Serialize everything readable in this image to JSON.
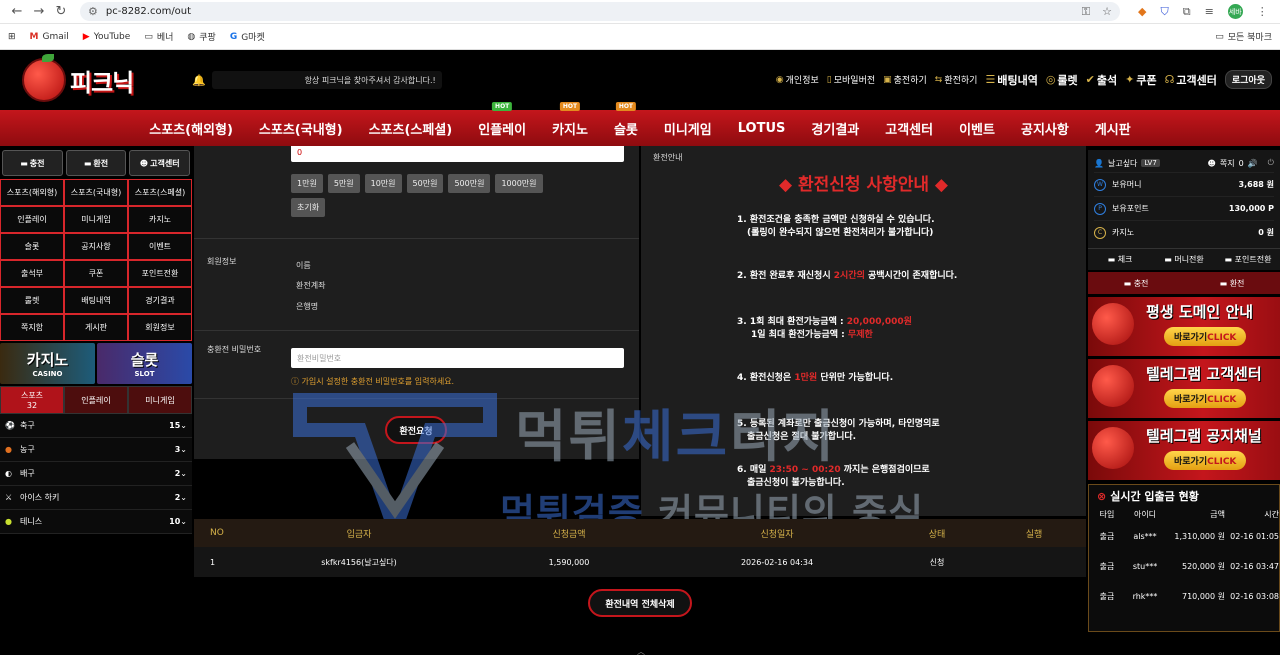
{
  "browser": {
    "url": "pc-8282.com/out",
    "bookmarks": [
      "Gmail",
      "YouTube",
      "베너",
      "쿠팡",
      "G마켓"
    ],
    "all_bookmarks": "모든 북마크",
    "profile_initial": "세바"
  },
  "header": {
    "logo_text": "피크닉",
    "marquee": "항상 피크닉을 찾아주셔서 감사합니다.!",
    "top_links": [
      "개인정보",
      "모바일버전",
      "충전하기",
      "환전하기",
      "배팅내역",
      "룰렛",
      "출석",
      "쿠폰",
      "고객센터"
    ],
    "logout": "로그아웃"
  },
  "nav": {
    "items": [
      "스포츠(해외형)",
      "스포츠(국내형)",
      "스포츠(스페셜)",
      "인플레이",
      "카지노",
      "슬롯",
      "미니게임",
      "LOTUS",
      "경기결과",
      "고객센터",
      "이벤트",
      "공지사항",
      "게시판"
    ],
    "hot_label": "HOT"
  },
  "left": {
    "top_buttons": [
      "충전",
      "환전",
      "고객센터"
    ],
    "grid": [
      "스포츠(해외형)",
      "스포츠(국내형)",
      "스포츠(스페셜)",
      "인플레이",
      "미니게임",
      "카지노",
      "슬롯",
      "공지사항",
      "이벤트",
      "출석부",
      "쿠폰",
      "포인트전환",
      "룰렛",
      "배팅내역",
      "경기결과",
      "쪽지함",
      "게시판",
      "회원정보"
    ],
    "banner_casino": {
      "title": "카지노",
      "sub": "CASINO"
    },
    "banner_slot": {
      "title": "슬롯",
      "sub": "SLOT"
    },
    "sport_tabs": [
      {
        "label": "스포츠",
        "count": "32"
      },
      {
        "label": "인플레이"
      },
      {
        "label": "미니게임"
      }
    ],
    "sports": [
      {
        "name": "축구",
        "count": "15"
      },
      {
        "name": "농구",
        "count": "3"
      },
      {
        "name": "배구",
        "count": "2"
      },
      {
        "name": "아이스 하키",
        "count": "2"
      },
      {
        "name": "테니스",
        "count": "10"
      }
    ]
  },
  "form": {
    "amount_value": "0",
    "amount_buttons": [
      "1만원",
      "5만원",
      "10만원",
      "50만원",
      "500만원",
      "1000만원"
    ],
    "reset": "초기화",
    "member_info_label": "회원정보",
    "member_fields": [
      "이름",
      "환전계좌",
      "은행명"
    ],
    "password_label": "충환전 비밀번호",
    "password_placeholder": "환전비밀번호",
    "password_help": "가입시 설정한 충환전 비밀번호를 입력하세요.",
    "submit": "환전요청"
  },
  "info": {
    "title": "환전안내",
    "heading": "◆ 환전신청 사항안내 ◆",
    "n1a": "1. 환전조건을 충족한 금액만 신청하실 수 있습니다.",
    "n1b": "(롤링이 완수되지 않으면 환전처리가 불가합니다)",
    "n2a": "2. 환전 완료후 재신청시 ",
    "n2r": "2시간의",
    "n2b": " 공백시간이 존재합니다.",
    "n3a": "3. 1회 최대 환전가능금액 : ",
    "n3r": "20,000,000원",
    "n3b": "1일 최대 환전가능금액 : ",
    "n3r2": "무제한",
    "n4a": "4. 환전신청은 ",
    "n4r": "1만원",
    "n4b": " 단위만 가능합니다.",
    "n5a": "5. 등록된 계좌로만 출금신청이 가능하며, 타인명의로",
    "n5b": "출금신청은 절대 불가합니다.",
    "n6a": "6. 매일 ",
    "n6r": "23:50 ~ 00:20",
    "n6b": " 까지는 은행점검이므로",
    "n6c": "출금신청이 불가능합니다."
  },
  "history": {
    "headers": [
      "NO",
      "입금자",
      "신청금액",
      "신청일자",
      "상태",
      "실행"
    ],
    "rows": [
      {
        "no": "1",
        "name": "skfkr4156(날고싶다)",
        "amount": "1,590,000",
        "date": "2026-02-16 04:34",
        "status": "신청",
        "action": ""
      }
    ],
    "delete_all": "환전내역 전체삭제"
  },
  "user": {
    "name": "날고싶다",
    "level": "LV7",
    "message_label": "쪽지",
    "message_count": "0",
    "balances": [
      {
        "label": "보유머니",
        "value": "3,688 원",
        "icon": "W"
      },
      {
        "label": "보유포인트",
        "value": "130,000 P",
        "icon": "P"
      },
      {
        "label": "카지노",
        "value": "0 원",
        "icon": "C"
      }
    ],
    "buttons": [
      "체크",
      "머니전환",
      "포인트전환"
    ],
    "buttons2": [
      "충전",
      "환전"
    ]
  },
  "promos": [
    {
      "title": "평생 도메인 안내",
      "go": "바로가기",
      "click": "CLICK"
    },
    {
      "title": "텔레그램 고객센터",
      "go": "바로가기",
      "click": "CLICK"
    },
    {
      "title": "텔레그램 공지채널",
      "go": "바로가기",
      "click": "CLICK"
    }
  ],
  "live": {
    "title": "실시간 입출금 현황",
    "headers": [
      "타입",
      "아이디",
      "금액",
      "시간"
    ],
    "rows": [
      {
        "type": "출금",
        "id": "als***",
        "amount": "1,310,000 원",
        "time": "02-16 01:05"
      },
      {
        "type": "출금",
        "id": "stu***",
        "amount": "520,000 원",
        "time": "02-16 03:47"
      },
      {
        "type": "출금",
        "id": "rhk***",
        "amount": "710,000 원",
        "time": "02-16 03:08"
      }
    ]
  },
  "watermark": {
    "line1a": "먹튀",
    "line1b": "체크",
    "line1c": "티지",
    "line2a": "먹튀검증",
    "line2b": " 커뮤니티의 중심"
  }
}
